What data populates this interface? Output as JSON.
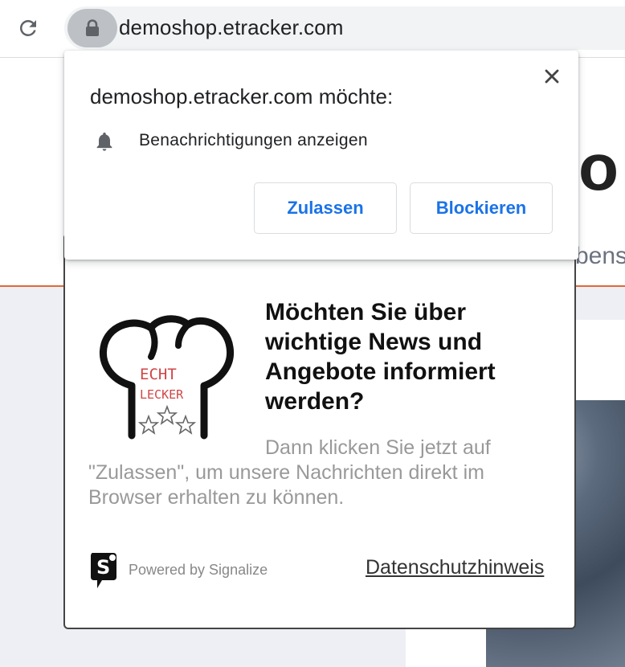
{
  "toolbar": {
    "url": "demoshop.etracker.com",
    "icons": {
      "reload": "reload-icon",
      "lock": "lock-icon"
    }
  },
  "background_page": {
    "heading_fragment": "o",
    "subtitle_fragment": "bens",
    "colors": {
      "accent_line": "#e0693a",
      "section_bg": "#eeeff4"
    }
  },
  "permission_prompt": {
    "title": "demoshop.etracker.com möchte:",
    "permission_label": "Benachrichtigungen anzeigen",
    "allow_label": "Zulassen",
    "block_label": "Blockieren",
    "close_icon": "close-icon",
    "permission_icon": "bell-icon",
    "colors": {
      "button_text": "#1a73e8"
    }
  },
  "signalize_popup": {
    "logo_text_line1": "ECHT",
    "logo_text_line2": "LECKER",
    "title": "Möchten Sie über wichtige News und Angebote informiert werden?",
    "body": "Dann klicken Sie jetzt auf \"Zulassen\", um unsere Nachrichten direkt im Browser erhalten zu können.",
    "powered_by": "Powered by Signalize",
    "privacy_link": "Datenschutzhinweis"
  }
}
